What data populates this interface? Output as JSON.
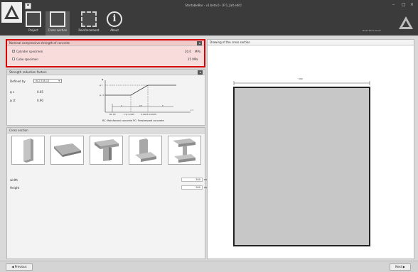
{
  "window": {
    "title": "StartableBar - v1.beta.0 - [Fr1_[alt.edit]",
    "version": "Build 2021-10-07",
    "minimize": "–",
    "maximize": "□",
    "close": "×"
  },
  "ribbon": {
    "tabs": [
      {
        "label": "Project"
      },
      {
        "label": "Cross section"
      },
      {
        "label": "Reinforcement"
      },
      {
        "label": "About"
      }
    ],
    "active_tab": "Cross section"
  },
  "compressive": {
    "title": "Nominal compressive strength of concrete",
    "cylinder_label": "Cylinder specimen",
    "cylinder_checked": true,
    "cylinder_value": "20.0",
    "cylinder_unit": "MPa",
    "cube_label": "Cube specimen",
    "cube_checked": false,
    "cube_value": "25 MPa"
  },
  "reduction": {
    "title": "Strength reduction factors",
    "defined_by_label": "Defined by",
    "defined_by_value": "ACI 318-11",
    "phi_c_label": "φ c",
    "phi_c_value": "0.65",
    "phi_ct_label": "φ ct",
    "phi_ct_value": "0.90",
    "chart": {
      "y_label": "φ",
      "phi_t_label": "φ t",
      "phi_c_label": "φ c,t",
      "x_label": "ε t",
      "zones": [
        "C",
        "CT",
        "T"
      ],
      "ticks": [
        "RC  PC",
        "ε ty  0.005",
        "0.0025  0.0025"
      ],
      "legend": "RC: Reinforced concrete   PC: Prestressed concrete"
    }
  },
  "section": {
    "title": "Cross section",
    "width_label": "width",
    "width_value": "500",
    "width_unit": "mm",
    "height_label": "Height",
    "height_value": "500",
    "height_unit": "mm"
  },
  "drawing": {
    "title": "Drawing of the cross section",
    "dim_label": "500"
  },
  "nav": {
    "previous": "Previous",
    "next": "Next"
  },
  "colors": {
    "highlight": "#d60000",
    "titlebar": "#3b3b3b"
  }
}
